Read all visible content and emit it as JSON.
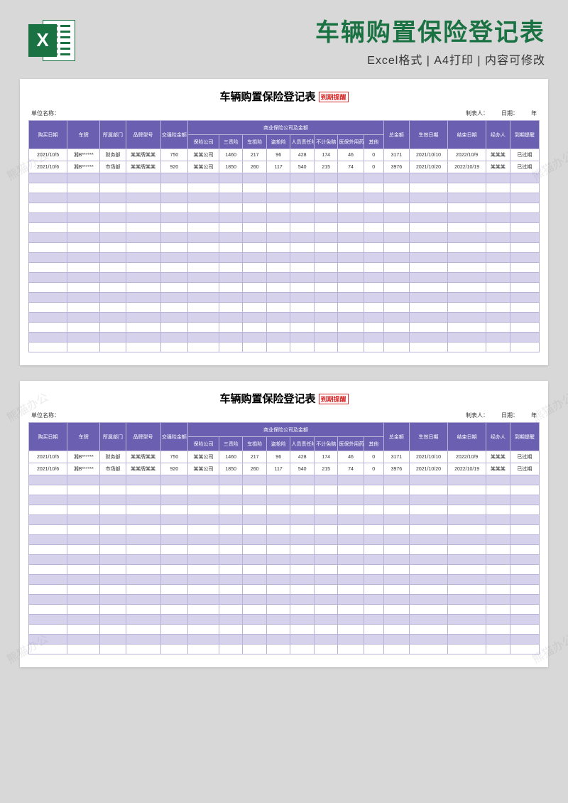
{
  "header": {
    "main_title": "车辆购置保险登记表",
    "subtitle": "Excel格式 | A4打印 | 内容可修改",
    "icon_letter": "X"
  },
  "watermark_text": "熊猫办公",
  "sheet": {
    "title": "车辆购置保险登记表",
    "expire_tag": "到期提醒",
    "meta": {
      "unit_label": "单位名称：",
      "preparer_label": "制表人：",
      "date_label": "日期：",
      "year_label": "年"
    },
    "columns": {
      "c1": "购买日期",
      "c2": "车牌",
      "c3": "所属部门",
      "c4": "品牌型号",
      "c5": "交强险金额",
      "group": "商业保险公司及金额",
      "g1": "保险公司",
      "g2": "三责险",
      "g3": "车损险",
      "g4": "盗抢险",
      "g5": "人员责任险",
      "g6": "不计免赔",
      "g7": "医保外用药",
      "g8": "其他",
      "c6": "总金额",
      "c7": "生效日期",
      "c8": "结束日期",
      "c9": "经办人",
      "c10": "到期提醒"
    },
    "rows": [
      {
        "c1": "2021/10/5",
        "c2": "湘B******",
        "c3": "财务部",
        "c4": "某某牌某某",
        "c5": "750",
        "g1": "某某公司",
        "g2": "1460",
        "g3": "217",
        "g4": "96",
        "g5": "428",
        "g6": "174",
        "g7": "46",
        "g8": "0",
        "c6": "3171",
        "c7": "2021/10/10",
        "c8": "2022/10/9",
        "c9": "某某某",
        "c10": "已过期"
      },
      {
        "c1": "2021/10/6",
        "c2": "湘B******",
        "c3": "市场部",
        "c4": "某某牌某某",
        "c5": "920",
        "g1": "某某公司",
        "g2": "1850",
        "g3": "260",
        "g4": "117",
        "g5": "540",
        "g6": "215",
        "g7": "74",
        "g8": "0",
        "c6": "3976",
        "c7": "2021/10/20",
        "c8": "2022/10/19",
        "c9": "某某某",
        "c10": "已过期"
      }
    ],
    "empty_row_count": 18
  }
}
